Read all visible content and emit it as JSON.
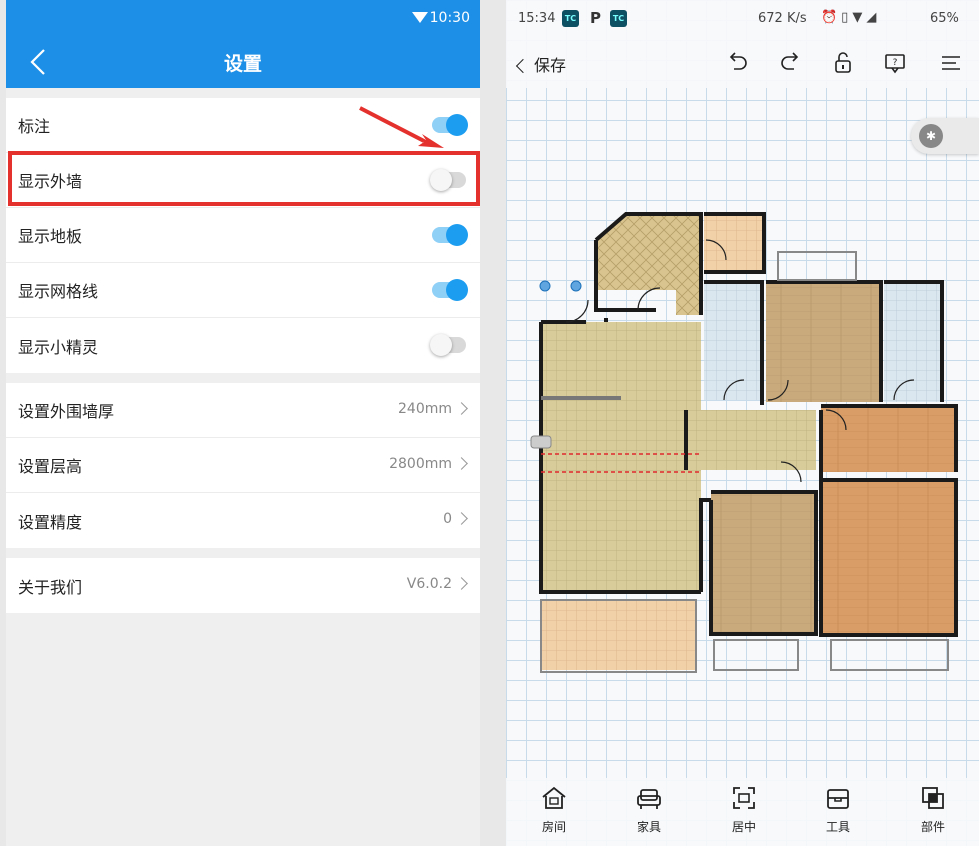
{
  "left_panel": {
    "status_bar": {
      "time": "10:30"
    },
    "header": {
      "title": "设置"
    },
    "toggles": [
      {
        "label": "标注",
        "on": true
      },
      {
        "label": "显示外墙",
        "on": false,
        "highlighted": true
      },
      {
        "label": "显示地板",
        "on": true
      },
      {
        "label": "显示网格线",
        "on": true
      },
      {
        "label": "显示小精灵",
        "on": false
      }
    ],
    "settings": [
      {
        "label": "设置外围墙厚",
        "value": "240mm"
      },
      {
        "label": "设置层高",
        "value": "2800mm"
      },
      {
        "label": "设置精度",
        "value": "0"
      }
    ],
    "about": {
      "label": "关于我们",
      "value": "V6.0.2"
    },
    "colors": {
      "accent": "#1e8fe6",
      "highlight": "#e4312d"
    }
  },
  "right_panel": {
    "status_bar": {
      "time": "15:34",
      "app_icon_text": "TC",
      "p_icon": "P",
      "speed": "672 K/s",
      "battery": "65%"
    },
    "toolbar": {
      "save_label": "保存",
      "icons": [
        "undo-icon",
        "redo-icon",
        "lock-icon",
        "help-icon",
        "menu-icon"
      ]
    },
    "bottom_nav": [
      {
        "label": "房间",
        "icon": "house-icon"
      },
      {
        "label": "家具",
        "icon": "sofa-icon"
      },
      {
        "label": "居中",
        "icon": "center-icon"
      },
      {
        "label": "工具",
        "icon": "toolbox-icon"
      },
      {
        "label": "部件",
        "icon": "layers-icon"
      }
    ]
  }
}
